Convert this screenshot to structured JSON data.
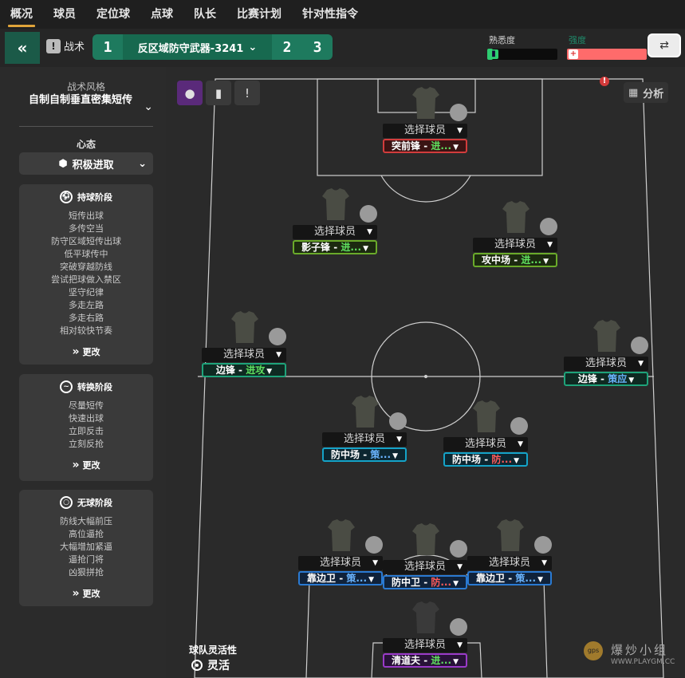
{
  "nav": {
    "tabs": [
      "概况",
      "球员",
      "定位球",
      "点球",
      "队长",
      "比赛计划",
      "针对性指令"
    ]
  },
  "tactics_bar": {
    "back_icon": "«",
    "label": "战术",
    "slot1": "1",
    "current_tactic": "反区域防守武器-3241",
    "slot2": "2",
    "slot3": "3"
  },
  "meters": {
    "familiarity_label": "熟悉度",
    "familiarity_level": 0.08,
    "intensity_label": "强度",
    "intensity_level": 1.0,
    "colors": {
      "familiarity": "#2ecc71",
      "intensity": "#ff6b6b"
    }
  },
  "left_panel": {
    "style_caption": "战术风格",
    "style_value": "自制自制垂直密集短传",
    "mentality_caption": "心态",
    "mentality_value": "积极进取",
    "in_possession": {
      "title": "持球阶段",
      "items": [
        "短传出球",
        "多传空当",
        "防守区域短传出球",
        "低平球传中",
        "突破穿越防线",
        "尝试把球做入禁区",
        "坚守纪律",
        "多走左路",
        "多走右路",
        "相对较快节奏"
      ],
      "more": "更改"
    },
    "transition": {
      "title": "转换阶段",
      "items": [
        "尽量短传",
        "快速出球",
        "立即反击",
        "立刻反抢"
      ],
      "more": "更改"
    },
    "out_of_possession": {
      "title": "无球阶段",
      "items": [
        "防线大幅前压",
        "高位逼抢",
        "大幅增加紧逼",
        "逼抢门将",
        "凶狠拼抢"
      ],
      "more": "更改"
    }
  },
  "pitch": {
    "analysis_label": "分析",
    "warning_icon": "!",
    "team_flex_label": "球队灵活性",
    "team_flex_value": "灵活",
    "watermark": "爆炒小组",
    "watermark_url": "WWW.PLAYGM.CC",
    "select_player": "选择球员",
    "players": [
      {
        "id": "st",
        "role": "突前锋",
        "duty": "进...",
        "color": "red"
      },
      {
        "id": "ss",
        "role": "影子锋",
        "duty": "进...",
        "color": "green"
      },
      {
        "id": "am",
        "role": "攻中场",
        "duty": "进...",
        "color": "green"
      },
      {
        "id": "lw",
        "role": "边锋",
        "duty": "进攻",
        "color": "teal"
      },
      {
        "id": "rw",
        "role": "边锋",
        "duty": "策应",
        "color": "teal"
      },
      {
        "id": "dm1",
        "role": "防中场",
        "duty": "策...",
        "color": "cyan"
      },
      {
        "id": "dm2",
        "role": "防中场",
        "duty": "防...",
        "color": "cyan"
      },
      {
        "id": "wbl",
        "role": "靠边卫",
        "duty": "策...",
        "color": "blue"
      },
      {
        "id": "cd",
        "role": "防中卫",
        "duty": "防...",
        "color": "blue"
      },
      {
        "id": "wbr",
        "role": "靠边卫",
        "duty": "策...",
        "color": "blue"
      },
      {
        "id": "sw",
        "role": "清道夫",
        "duty": "进...",
        "color": "purple"
      }
    ]
  }
}
